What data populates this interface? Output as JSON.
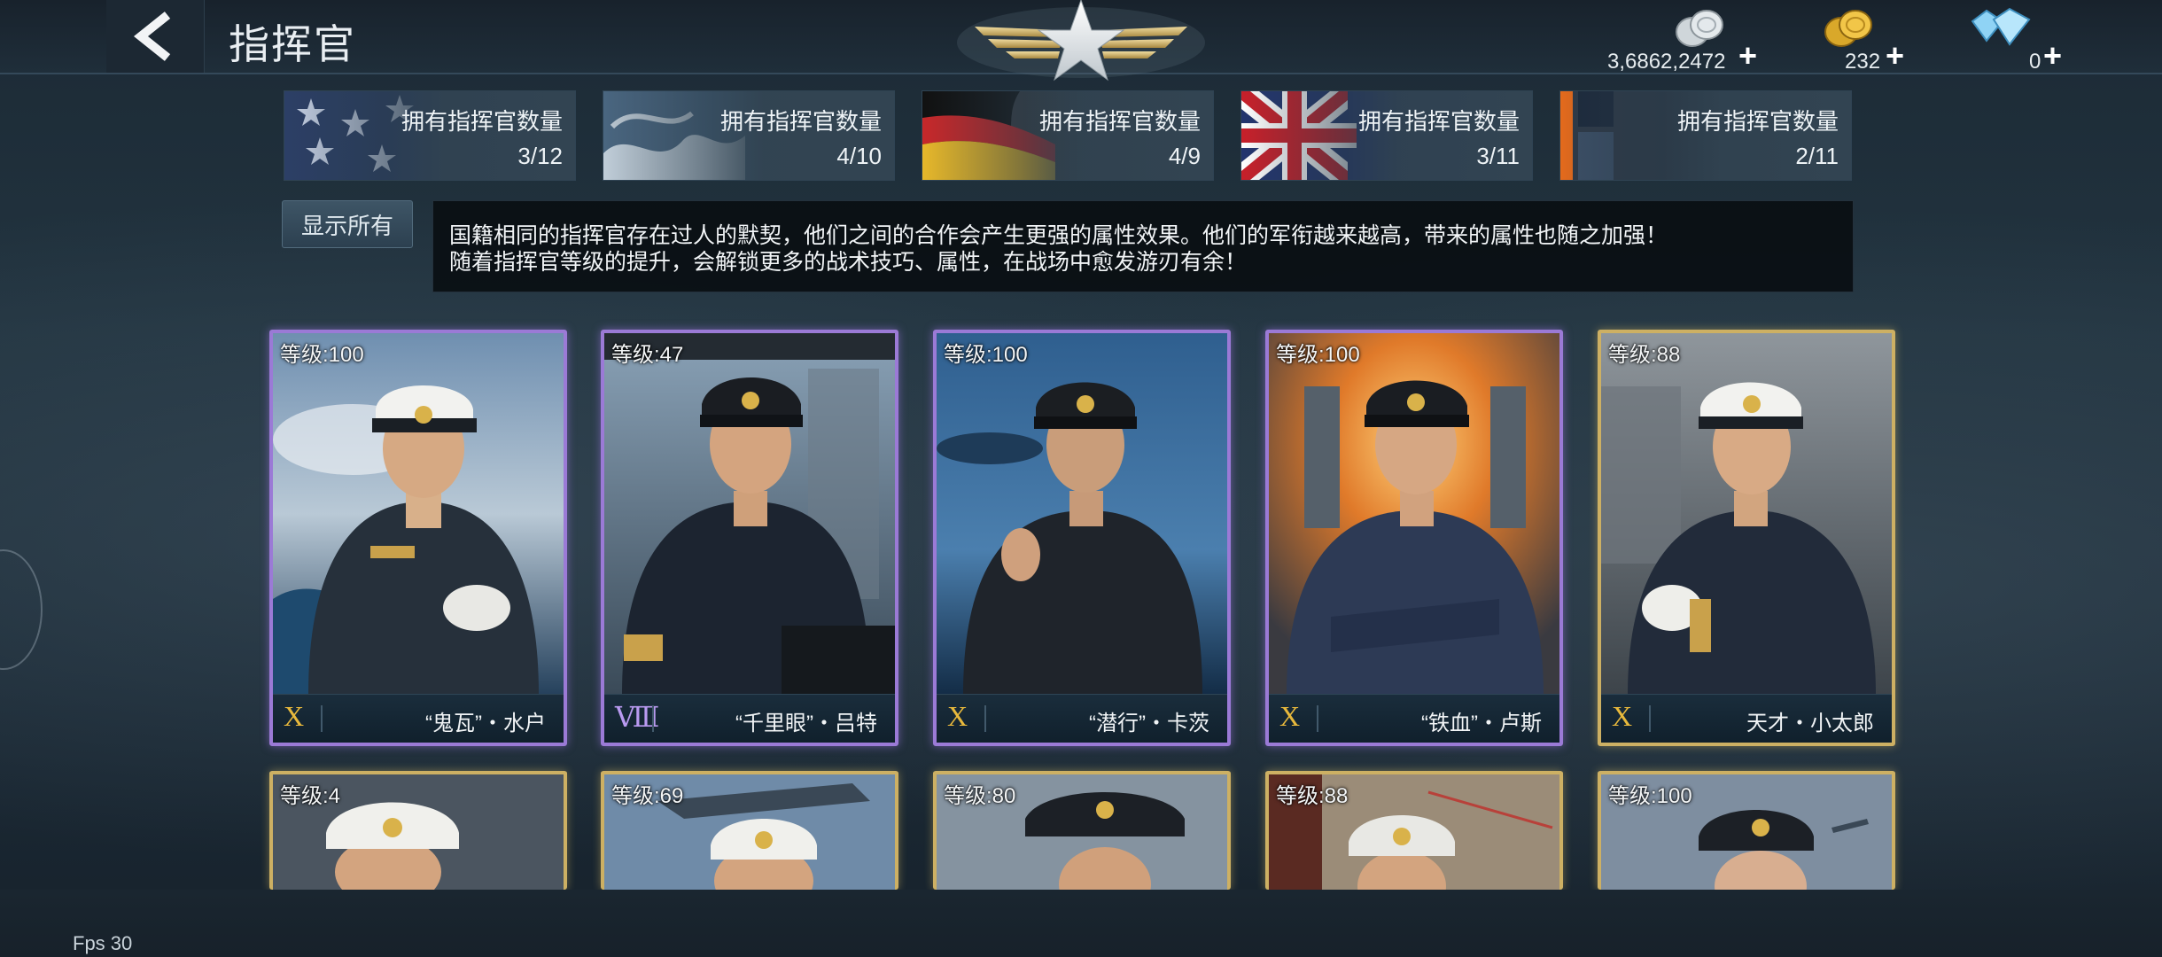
{
  "header": {
    "title": "指挥官",
    "back_icon": "back-arrow-icon",
    "emblem_icon": "star-wings-emblem-icon"
  },
  "currencies": [
    {
      "name": "silver",
      "icon": "silver-coins-icon",
      "value": "3,6862,2472",
      "plus": "+"
    },
    {
      "name": "gold",
      "icon": "gold-coins-icon",
      "value": "232",
      "plus": "+"
    },
    {
      "name": "diamond",
      "icon": "diamond-icon",
      "value": "0",
      "plus": "+"
    }
  ],
  "nations": [
    {
      "id": "usa",
      "label": "拥有指挥官数量",
      "count": "3/12"
    },
    {
      "id": "japan",
      "label": "拥有指挥官数量",
      "count": "4/10"
    },
    {
      "id": "germany",
      "label": "拥有指挥官数量",
      "count": "4/9"
    },
    {
      "id": "uk",
      "label": "拥有指挥官数量",
      "count": "3/11"
    },
    {
      "id": "other",
      "label": "拥有指挥官数量",
      "count": "2/11"
    }
  ],
  "show_all_label": "显示所有",
  "description": [
    "国籍相同的指挥官存在过人的默契，他们之间的合作会产生更强的属性效果。他们的军衔越来越高，带来的属性也随之加强！",
    "随着指挥官等级的提升，会解锁更多的战术技巧、属性，在战场中愈发游刃有余！"
  ],
  "commanders_row1": [
    {
      "level": "等级:100",
      "rank": "X",
      "name": "“鬼瓦”・水户",
      "frame": "purple"
    },
    {
      "level": "等级:47",
      "rank": "Ⅷ",
      "name": "“千里眼”・吕特",
      "frame": "purple"
    },
    {
      "level": "等级:100",
      "rank": "X",
      "name": "“潜行”・卡茨",
      "frame": "purple"
    },
    {
      "level": "等级:100",
      "rank": "X",
      "name": "“铁血”・卢斯",
      "frame": "purple"
    },
    {
      "level": "等级:88",
      "rank": "X",
      "name": "天才・小太郎",
      "frame": "gold"
    }
  ],
  "commanders_row2": [
    {
      "level": "等级:4",
      "frame": "gold"
    },
    {
      "level": "等级:69",
      "frame": "gold"
    },
    {
      "level": "等级:80",
      "frame": "gold"
    },
    {
      "level": "等级:88",
      "frame": "gold"
    },
    {
      "level": "等级:100",
      "frame": "gold"
    }
  ],
  "fps": "Fps 30"
}
